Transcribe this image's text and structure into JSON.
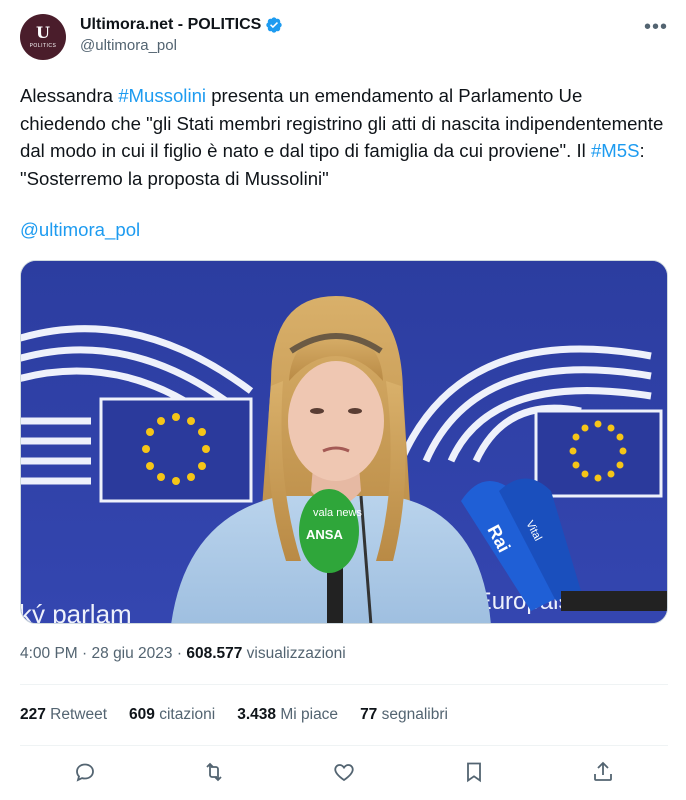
{
  "author": {
    "display_name": "Ultimora.net - POLITICS",
    "handle": "@ultimora_pol",
    "avatar_letter": "U",
    "avatar_caption": "POLITICS"
  },
  "tweet": {
    "t1": "Alessandra ",
    "hashtag1": "#Mussolini",
    "t2": " presenta un emendamento al Parlamento Ue chiedendo che \"gli Stati membri registrino gli atti di nascita indipendentemente dal modo in cui il figlio è nato e dal tipo di famiglia da cui proviene\". Il ",
    "hashtag2": "#M5S",
    "t3": ": \"Sosterremo la proposta di Mussolini\"",
    "mention": "@ultimora_pol"
  },
  "media": {
    "mic_green_brand": "ANSA",
    "mic_green_top": "vala news",
    "mic_blue_brand": "Rai",
    "mic_blue2": "Vital",
    "backdrop_left_text": "ký parlam",
    "backdrop_right_text": "et Europäisches Parla"
  },
  "meta": {
    "time": "4:00 PM",
    "sep": " · ",
    "date": "28 giu 2023",
    "views_count": "608.577",
    "views_label": " visualizzazioni"
  },
  "stats": [
    {
      "count": "227",
      "label": " Retweet"
    },
    {
      "count": "609",
      "label": " citazioni"
    },
    {
      "count": "3.438",
      "label": " Mi piace"
    },
    {
      "count": "77",
      "label": " segnalibri"
    }
  ],
  "colors": {
    "link": "#1d9bf0",
    "secondary": "#536471",
    "eu_blue": "#2e3fa3",
    "star": "#f5c518"
  },
  "actions": [
    "reply-icon",
    "retweet-icon",
    "like-icon",
    "bookmark-icon",
    "share-icon"
  ]
}
